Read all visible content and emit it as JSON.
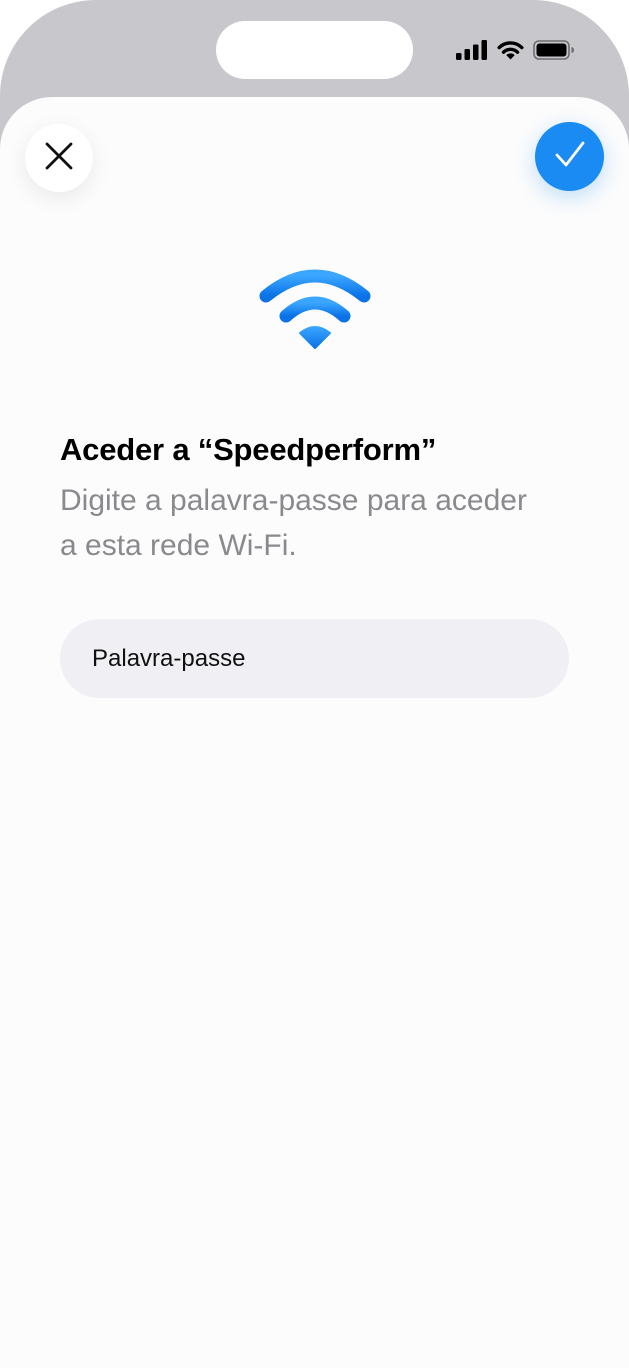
{
  "status_bar": {
    "icons": [
      "cellular-signal-icon",
      "wifi-icon",
      "battery-icon"
    ]
  },
  "toolbar": {
    "close_icon": "close-icon",
    "confirm_icon": "checkmark-icon"
  },
  "hero": {
    "icon": "wifi-icon",
    "color": "#1a8bf3"
  },
  "dialog": {
    "title": "Aceder a “Speedperform”",
    "subtitle": "Digite a palavra-passe para aceder a esta rede Wi-Fi."
  },
  "password": {
    "placeholder": "Palavra-passe",
    "value": ""
  },
  "colors": {
    "accent": "#1a8bf3",
    "field_background": "#f0f0f4",
    "secondary_text": "#8a8a8e"
  }
}
